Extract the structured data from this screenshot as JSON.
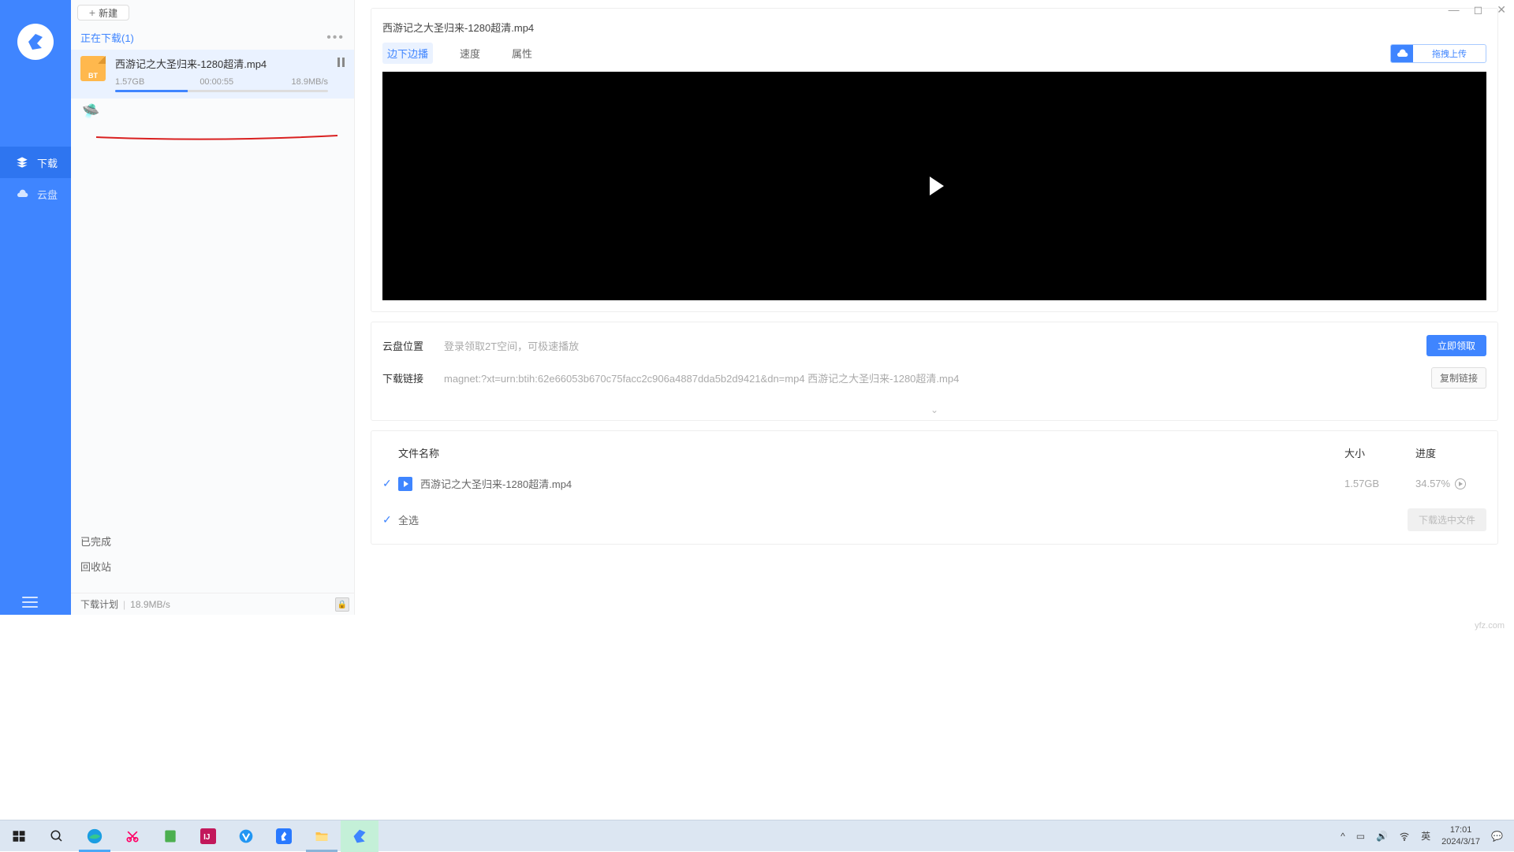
{
  "sidebar": {
    "items": [
      {
        "label": "下载"
      },
      {
        "label": "云盘"
      }
    ]
  },
  "middle": {
    "new_btn": "新建",
    "section_title": "正在下载(1)",
    "download": {
      "name": "西游记之大圣归来-1280超清.mp4",
      "size": "1.57GB",
      "eta": "00:00:55",
      "speed": "18.9MB/s",
      "progress_pct": 34
    },
    "links": {
      "done": "已完成",
      "trash": "回收站"
    },
    "plan": {
      "label": "下载计划",
      "speed": "18.9MB/s"
    }
  },
  "detail": {
    "file_title": "西游记之大圣归来-1280超清.mp4",
    "tabs": [
      "边下边播",
      "速度",
      "属性"
    ],
    "upload_btn": "拖拽上传",
    "cloud_label": "云盘位置",
    "cloud_hint": "登录领取2T空间，可极速播放",
    "claim_btn": "立即领取",
    "link_label": "下载链接",
    "link_value": "magnet:?xt=urn:btih:62e66053b670c75facc2c906a4887dda5b2d9421&dn=mp4 西游记之大圣归来-1280超清.mp4",
    "copy_btn": "复制链接",
    "table": {
      "head_name": "文件名称",
      "head_size": "大小",
      "head_prog": "进度",
      "rows": [
        {
          "name": "西游记之大圣归来-1280超清.mp4",
          "size": "1.57GB",
          "progress": "34.57%"
        }
      ],
      "select_all": "全选",
      "dl_selected": "下载选中文件"
    }
  },
  "watermark": "yfz.com",
  "taskbar": {
    "ime": "英",
    "time": "17:01",
    "date": "2024/3/17"
  }
}
